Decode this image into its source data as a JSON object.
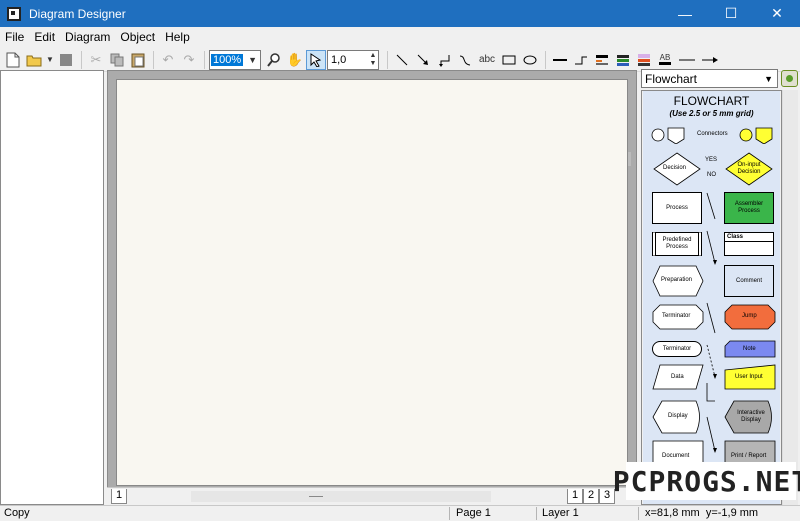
{
  "window": {
    "title": "Diagram Designer",
    "controls": {
      "minimize": "—",
      "maximize": "☐",
      "close": "✕"
    }
  },
  "menu": [
    "File",
    "Edit",
    "Diagram",
    "Object",
    "Help"
  ],
  "toolbar": {
    "zoom_value": "100%",
    "line_width_value": "1,0",
    "text_tool_label": "abc",
    "font_tool_label": "AB"
  },
  "page_tabs": {
    "left_tab": "1",
    "right_tabs": [
      "1",
      "2",
      "3"
    ]
  },
  "stencil": {
    "selected": "Flowchart",
    "title": "FLOWCHART",
    "subtitle": "(Use 2.5 or 5 mm grid)",
    "labels": {
      "connectors": "Connectors",
      "decision": "Decision",
      "yes": "YES",
      "no": "NO",
      "on_input_decision": "On-input Decision",
      "process": "Process",
      "assembler_process": "Assembler Process",
      "predefined_process": "Predefined Process",
      "class": "Class",
      "preparation": "Preparation",
      "comment": "Comment",
      "terminator1": "Terminator",
      "jump": "Jump",
      "terminator2": "Terminator",
      "note": "Note",
      "data": "Data",
      "user_input": "User Input",
      "display": "Display",
      "interactive_display": "Interactive Display",
      "document": "Document",
      "print_report": "Print / Report"
    },
    "colors": {
      "assembler": "#3ab54a",
      "yellow": "#ffff33",
      "jump": "#f26d3d",
      "note": "#7b89f0",
      "interactive": "#a8a8a8",
      "print": "#b5b5b5"
    }
  },
  "status": {
    "action": "Copy",
    "page": "Page 1",
    "layer": "Layer 1",
    "coords": "x=81,8 mm  y=-1,9 mm"
  },
  "watermark": "PCPROGS.NET"
}
